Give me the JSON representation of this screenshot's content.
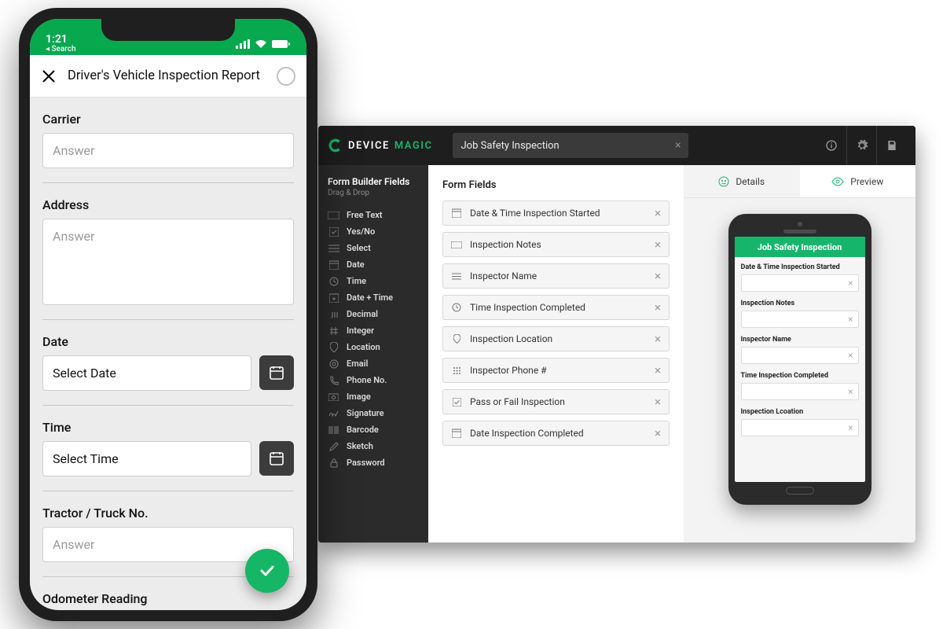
{
  "builder": {
    "brand_a": "DEVICE",
    "brand_b": "MAGIC",
    "form_name": "Job Safety Inspection",
    "sidebar_title": "Form Builder Fields",
    "sidebar_sub": "Drag & Drop",
    "field_types": [
      "Free Text",
      "Yes/No",
      "Select",
      "Date",
      "Time",
      "Date + Time",
      "Decimal",
      "Integer",
      "Location",
      "Email",
      "Phone No.",
      "Image",
      "Signature",
      "Barcode",
      "Sketch",
      "Password"
    ],
    "canvas_title": "Form Fields",
    "form_fields": [
      "Date & Time Inspection Started",
      "Inspection Notes",
      "Inspector Name",
      "Time Inspection Completed",
      "Inspection Location",
      "Inspector Phone #",
      "Pass or Fail Inspection",
      "Date Inspection Completed"
    ],
    "tab_details": "Details",
    "tab_preview": "Preview",
    "mini_title": "Job Safety Inspection",
    "mini_fields": [
      "Date & Time Inspection Started",
      "Inspection Notes",
      "Inspector Name",
      "Time Inspection Completed",
      "Inspection Lcoation"
    ]
  },
  "phone": {
    "time": "1:21",
    "back_search": "◂ Search",
    "title": "Driver's Vehicle Inspection Report",
    "q_carrier": "Carrier",
    "q_address": "Address",
    "q_date": "Date",
    "v_date": "Select Date",
    "q_time": "Time",
    "v_time": "Select Time",
    "q_tractor": "Tractor / Truck No.",
    "q_odo": "Odometer Reading",
    "ph_answer": "Answer"
  }
}
